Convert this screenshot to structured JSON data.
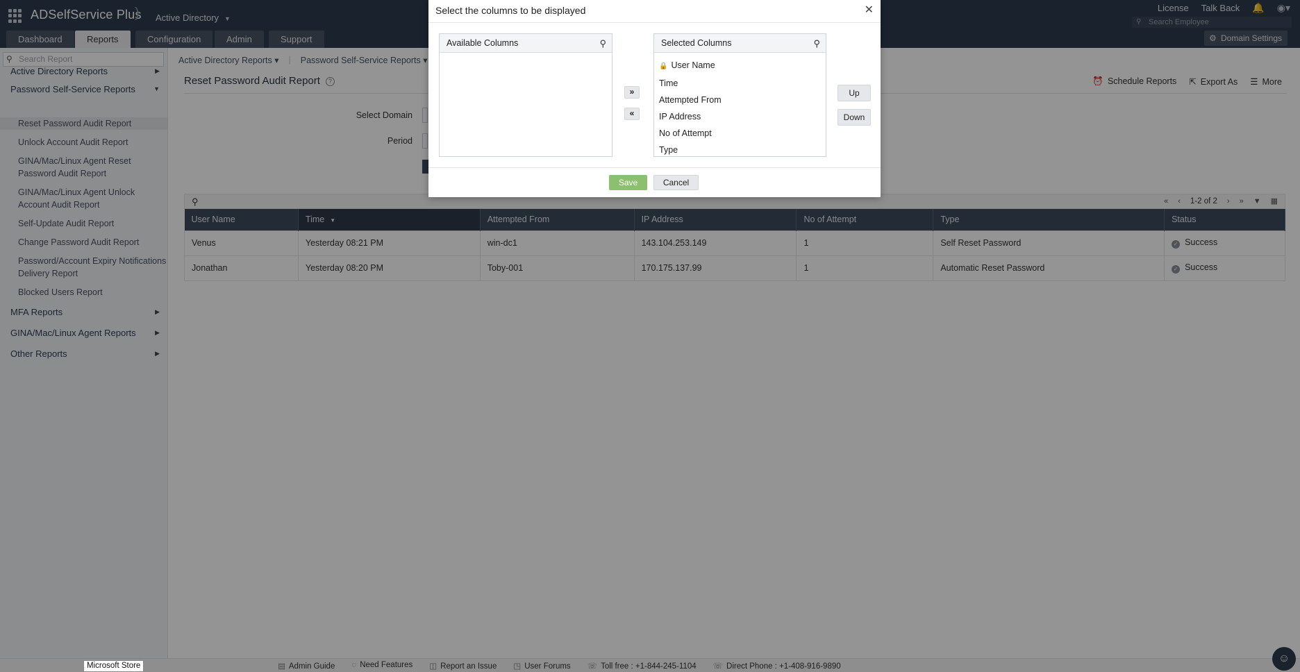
{
  "app": {
    "logo": "ADSelfService Plus",
    "product": "Active Directory",
    "top_links": [
      "License",
      "Talk Back"
    ],
    "search_placeholder": "Search Employee"
  },
  "nav": {
    "tabs": [
      "Dashboard",
      "Reports",
      "Configuration",
      "Admin",
      "Support"
    ],
    "active_tab": "Reports",
    "domain_settings": "Domain Settings"
  },
  "sidebar": {
    "search_placeholder": "Search Report",
    "categories": [
      "Active Directory Reports",
      "Password Self-Service Reports",
      "MFA Reports",
      "GINA/Mac/Linux Agent Reports",
      "Other Reports"
    ],
    "items": [
      "Reset Password Audit Report",
      "Unlock Account Audit Report",
      "GINA/Mac/Linux Agent Reset Password Audit Report",
      "GINA/Mac/Linux Agent Unlock Account Audit Report",
      "Self-Update Audit Report",
      "Change Password Audit Report",
      "Password/Account Expiry Notifications Delivery Report",
      "Blocked Users Report"
    ]
  },
  "subnav": [
    "Active Directory Reports ▾",
    "Password Self-Service Reports ▾"
  ],
  "content": {
    "title": "Reset Password Audit Report",
    "actions": [
      "Schedule Reports",
      "Export As",
      "More"
    ],
    "form": {
      "domain_label": "Select Domain",
      "period_label": "Period"
    }
  },
  "table": {
    "pager": "1-2 of 2",
    "columns": [
      "User Name",
      "Time",
      "Attempted From",
      "IP Address",
      "No of Attempt",
      "Type",
      "Status"
    ],
    "sorted_column": "Time",
    "rows": [
      [
        "Venus",
        "Yesterday 08:21 PM",
        "win-dc1",
        "143.104.253.149",
        "1",
        "Self Reset Password",
        "Success"
      ],
      [
        "Jonathan",
        "Yesterday 08:20 PM",
        "Toby-001",
        "170.175.137.99",
        "1",
        "Automatic Reset Password",
        "Success"
      ]
    ]
  },
  "modal": {
    "title": "Select the columns to be displayed",
    "available_header": "Available Columns",
    "selected_header": "Selected Columns",
    "available_columns": [],
    "selected_columns": [
      "User Name",
      "Time",
      "Attempted From",
      "IP Address",
      "No of Attempt",
      "Type"
    ],
    "locked_column": "User Name",
    "move_right": "»",
    "move_left": "«",
    "up": "Up",
    "down": "Down",
    "save": "Save",
    "cancel": "Cancel"
  },
  "footer": {
    "links": [
      "Admin Guide",
      "Need Features",
      "Report an Issue",
      "User Forums",
      "Toll free : +1-844-245-1104",
      "Direct Phone : +1-408-916-9890"
    ],
    "tooltip": "Microsoft Store"
  },
  "colors": {
    "topbar": "#2e3b4e",
    "table_header": "#3d4a5d",
    "save_button": "#8cbf6f"
  }
}
